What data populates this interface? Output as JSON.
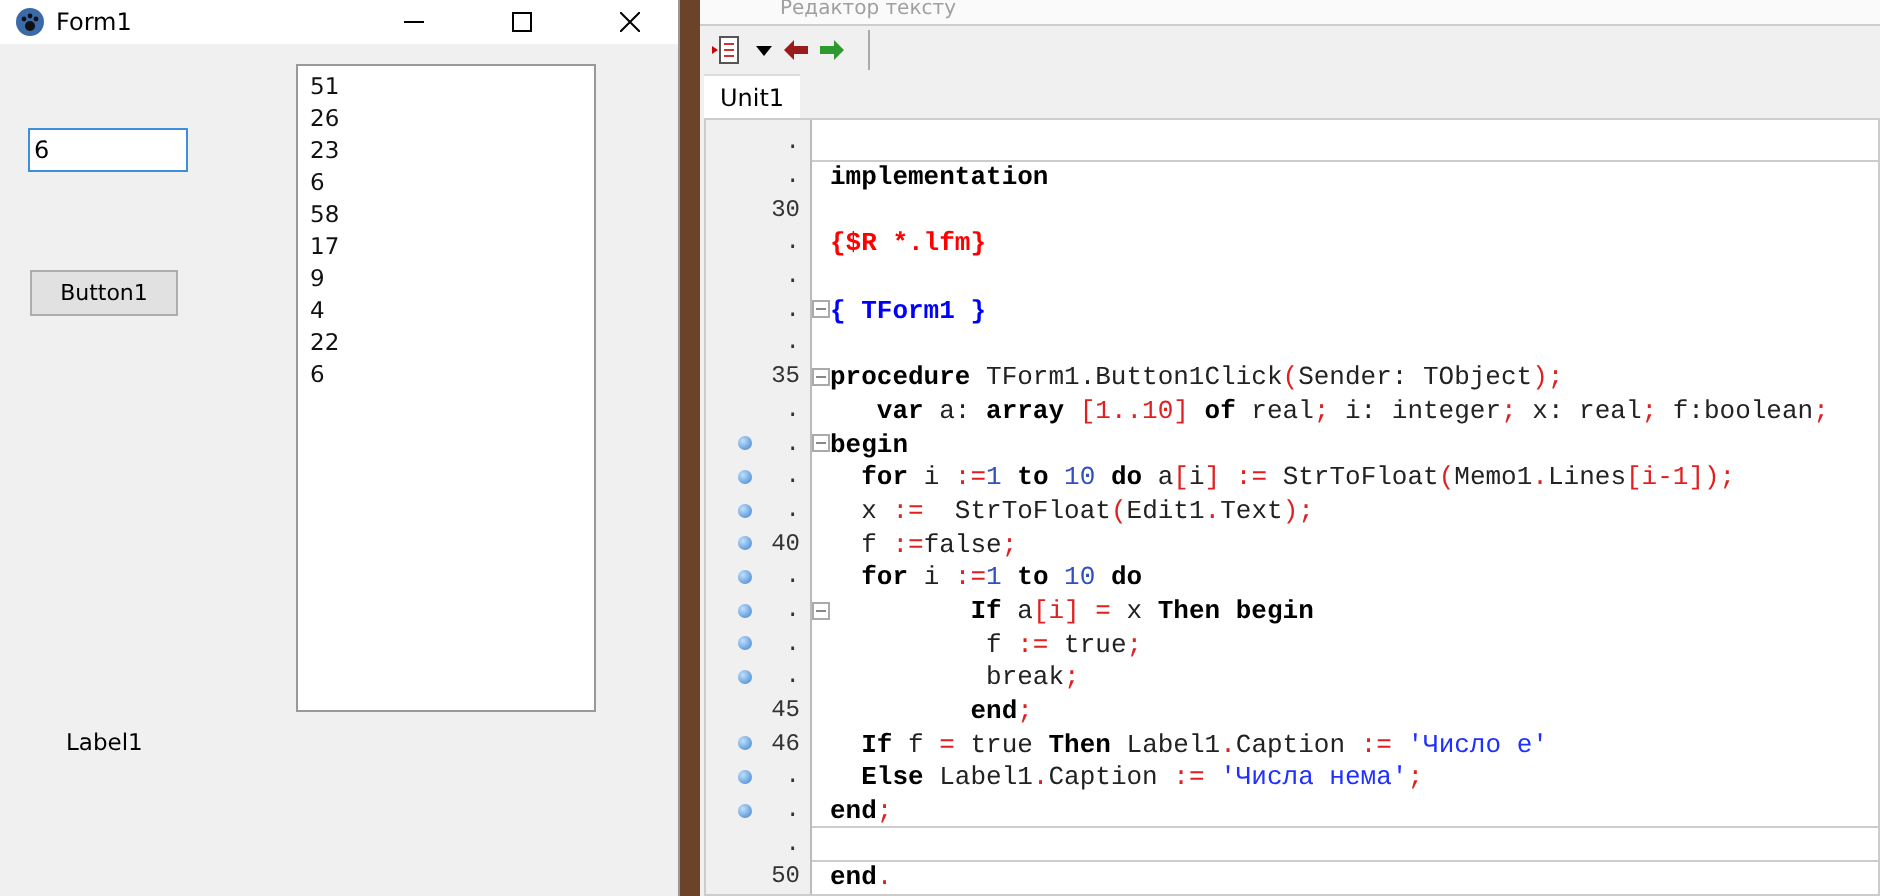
{
  "form_window": {
    "title": "Form1",
    "edit": {
      "value": "6"
    },
    "button": "Button1",
    "memo": [
      "51",
      "26",
      "23",
      "6",
      "58",
      "17",
      "9",
      "4",
      "22",
      "6"
    ],
    "label": "Label1"
  },
  "editor": {
    "title": "Редактор тексту",
    "tabs": [
      {
        "label": "Unit1",
        "selected": true
      }
    ],
    "lines": [
      {
        "number": ".",
        "marked": false,
        "fold": false,
        "divider": false
      },
      {
        "number": ".",
        "marked": false,
        "fold": false,
        "divider": true,
        "tokens": [
          {
            "kind": "kw",
            "text": "implementation"
          }
        ]
      },
      {
        "number": "30",
        "marked": false,
        "fold": false,
        "divider": false
      },
      {
        "number": ".",
        "marked": false,
        "fold": false,
        "divider": false,
        "tokens": [
          {
            "kind": "dir",
            "text": "{$R *.lfm}"
          }
        ]
      },
      {
        "number": ".",
        "marked": false,
        "fold": false,
        "divider": false
      },
      {
        "number": ".",
        "marked": false,
        "fold": true,
        "divider": false,
        "tokens": [
          {
            "kind": "com",
            "text": "{ TForm1 }"
          }
        ]
      },
      {
        "number": ".",
        "marked": false,
        "fold": false,
        "divider": false
      },
      {
        "number": "35",
        "marked": false,
        "fold": true,
        "divider": false,
        "tokens": [
          {
            "kind": "kw",
            "text": "procedure"
          },
          {
            "kind": "p",
            "text": " TForm1.Button1Click"
          },
          {
            "kind": "sym",
            "text": "("
          },
          {
            "kind": "p",
            "text": "Sender: TObject"
          },
          {
            "kind": "sym",
            "text": ");"
          }
        ]
      },
      {
        "number": ".",
        "marked": false,
        "fold": false,
        "divider": false,
        "tokens": [
          {
            "kind": "kw",
            "text": "   var"
          },
          {
            "kind": "p",
            "text": " a: "
          },
          {
            "kind": "kw",
            "text": "array"
          },
          {
            "kind": "sym",
            "text": " [1..10]"
          },
          {
            "kind": "kw",
            "text": " of"
          },
          {
            "kind": "p",
            "text": " real"
          },
          {
            "kind": "sym",
            "text": ";"
          },
          {
            "kind": "p",
            "text": " i: integer"
          },
          {
            "kind": "sym",
            "text": ";"
          },
          {
            "kind": "p",
            "text": " x: real"
          },
          {
            "kind": "sym",
            "text": ";"
          },
          {
            "kind": "p",
            "text": " f:boolean"
          },
          {
            "kind": "sym",
            "text": ";"
          }
        ]
      },
      {
        "number": ".",
        "marked": true,
        "fold": true,
        "divider": false,
        "tokens": [
          {
            "kind": "kw",
            "text": "begin"
          }
        ]
      },
      {
        "number": ".",
        "marked": true,
        "fold": false,
        "divider": false,
        "tokens": [
          {
            "kind": "kw",
            "text": "  for"
          },
          {
            "kind": "p",
            "text": " i "
          },
          {
            "kind": "sym",
            "text": ":="
          },
          {
            "kind": "num",
            "text": "1"
          },
          {
            "kind": "kw",
            "text": " to"
          },
          {
            "kind": "num",
            "text": " 10"
          },
          {
            "kind": "kw",
            "text": " do"
          },
          {
            "kind": "p",
            "text": " a"
          },
          {
            "kind": "sym",
            "text": "["
          },
          {
            "kind": "p",
            "text": "i"
          },
          {
            "kind": "sym",
            "text": "]"
          },
          {
            "kind": "sym",
            "text": " :="
          },
          {
            "kind": "p",
            "text": " StrToFloat"
          },
          {
            "kind": "sym",
            "text": "("
          },
          {
            "kind": "p",
            "text": "Memo1"
          },
          {
            "kind": "sym",
            "text": "."
          },
          {
            "kind": "p",
            "text": "Lines"
          },
          {
            "kind": "sym",
            "text": "[i-1]);"
          }
        ]
      },
      {
        "number": ".",
        "marked": true,
        "fold": false,
        "divider": false,
        "tokens": [
          {
            "kind": "p",
            "text": "  x "
          },
          {
            "kind": "sym",
            "text": ":="
          },
          {
            "kind": "p",
            "text": "  StrToFloat"
          },
          {
            "kind": "sym",
            "text": "("
          },
          {
            "kind": "p",
            "text": "Edit1"
          },
          {
            "kind": "sym",
            "text": "."
          },
          {
            "kind": "p",
            "text": "Text"
          },
          {
            "kind": "sym",
            "text": ");"
          }
        ]
      },
      {
        "number": "40",
        "marked": true,
        "fold": false,
        "divider": false,
        "tokens": [
          {
            "kind": "p",
            "text": "  f "
          },
          {
            "kind": "sym",
            "text": ":="
          },
          {
            "kind": "p",
            "text": "false"
          },
          {
            "kind": "sym",
            "text": ";"
          }
        ]
      },
      {
        "number": ".",
        "marked": true,
        "fold": false,
        "divider": false,
        "tokens": [
          {
            "kind": "kw",
            "text": "  for"
          },
          {
            "kind": "p",
            "text": " i "
          },
          {
            "kind": "sym",
            "text": ":="
          },
          {
            "kind": "num",
            "text": "1"
          },
          {
            "kind": "kw",
            "text": " to"
          },
          {
            "kind": "num",
            "text": " 10"
          },
          {
            "kind": "kw",
            "text": " do"
          }
        ]
      },
      {
        "number": ".",
        "marked": true,
        "fold": true,
        "divider": false,
        "tokens": [
          {
            "kind": "kw",
            "text": "         If"
          },
          {
            "kind": "p",
            "text": " a"
          },
          {
            "kind": "sym",
            "text": "[i]"
          },
          {
            "kind": "sym",
            "text": " ="
          },
          {
            "kind": "p",
            "text": " x "
          },
          {
            "kind": "kw",
            "text": "Then begin"
          }
        ]
      },
      {
        "number": ".",
        "marked": true,
        "fold": false,
        "divider": false,
        "tokens": [
          {
            "kind": "p",
            "text": "          f "
          },
          {
            "kind": "sym",
            "text": ":="
          },
          {
            "kind": "p",
            "text": " true"
          },
          {
            "kind": "sym",
            "text": ";"
          }
        ]
      },
      {
        "number": ".",
        "marked": true,
        "fold": false,
        "divider": false,
        "tokens": [
          {
            "kind": "p",
            "text": "          break"
          },
          {
            "kind": "sym",
            "text": ";"
          }
        ]
      },
      {
        "number": "45",
        "marked": false,
        "fold": false,
        "divider": false,
        "tokens": [
          {
            "kind": "kw",
            "text": "         end"
          },
          {
            "kind": "sym",
            "text": ";"
          }
        ]
      },
      {
        "number": "46",
        "marked": true,
        "fold": false,
        "divider": false,
        "tokens": [
          {
            "kind": "kw",
            "text": "  If"
          },
          {
            "kind": "p",
            "text": " f "
          },
          {
            "kind": "sym",
            "text": "="
          },
          {
            "kind": "p",
            "text": " true "
          },
          {
            "kind": "kw",
            "text": "Then"
          },
          {
            "kind": "p",
            "text": " Label1"
          },
          {
            "kind": "sym",
            "text": "."
          },
          {
            "kind": "p",
            "text": "Caption "
          },
          {
            "kind": "sym",
            "text": ":="
          },
          {
            "kind": "str",
            "text": " 'Число е'"
          }
        ]
      },
      {
        "number": ".",
        "marked": true,
        "fold": false,
        "divider": false,
        "tokens": [
          {
            "kind": "kw",
            "text": "  Else"
          },
          {
            "kind": "p",
            "text": " Label1"
          },
          {
            "kind": "sym",
            "text": "."
          },
          {
            "kind": "p",
            "text": "Caption "
          },
          {
            "kind": "sym",
            "text": ":="
          },
          {
            "kind": "str",
            "text": " 'Числа нема'"
          },
          {
            "kind": "sym",
            "text": ";"
          }
        ]
      },
      {
        "number": ".",
        "marked": true,
        "fold": false,
        "divider": false,
        "tokens": [
          {
            "kind": "kw",
            "text": "end"
          },
          {
            "kind": "sym",
            "text": ";"
          }
        ]
      },
      {
        "number": ".",
        "marked": false,
        "fold": false,
        "divider": true
      },
      {
        "number": "50",
        "marked": false,
        "fold": false,
        "divider": true,
        "tokens": [
          {
            "kind": "kw",
            "text": "end"
          },
          {
            "kind": "sym",
            "text": "."
          }
        ]
      }
    ]
  }
}
